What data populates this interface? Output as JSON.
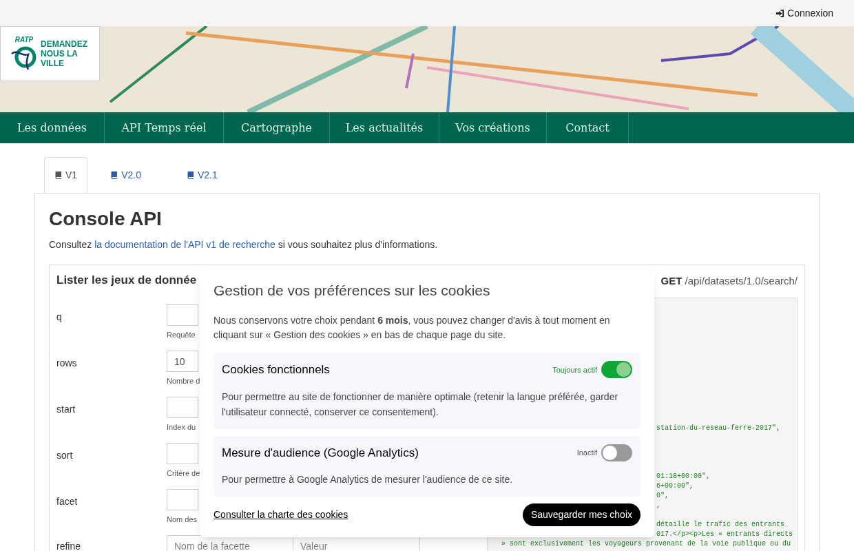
{
  "topbar": {
    "login": "Connexion"
  },
  "logo": {
    "brand": "RATP",
    "tagline": "DEMANDEZ NOUS LA VILLE"
  },
  "nav": [
    "Les données",
    "API Temps réel",
    "Cartographe",
    "Les actualités",
    "Vos créations",
    "Contact"
  ],
  "version_tabs": [
    {
      "label": "V1",
      "selected": true
    },
    {
      "label": "V2.0",
      "selected": false
    },
    {
      "label": "V2.1",
      "selected": false
    }
  ],
  "console": {
    "title": "Console API",
    "intro_before": "Consultez ",
    "intro_link": "la documentation de l'API v1 de recherche",
    "intro_after": " si vous souhaitez plus d'informations.",
    "section_title": "Lister les jeux de donnée",
    "method": "GET",
    "endpoint": "/api/datasets/1.0/search/",
    "params": [
      {
        "name": "q",
        "help": "Requête"
      },
      {
        "name": "rows",
        "value": "10",
        "help": "Nombre d"
      },
      {
        "name": "start",
        "help": "Index du"
      },
      {
        "name": "sort",
        "help": "Critère de"
      },
      {
        "name": "facet",
        "help": "Nom des"
      }
    ],
    "refine": {
      "name": "refine",
      "placeholder_key": "Nom de la facette",
      "placeholder_value": "Valeur"
    },
    "code_lines": [
      {
        "kind": "clipped",
        "text": "station-du-reseau-ferre-2017\","
      },
      {
        "kind": "gap"
      },
      {
        "kind": "gap"
      },
      {
        "kind": "gap"
      },
      {
        "kind": "gap"
      },
      {
        "kind": "clipped",
        "text": "01:18+00:00\","
      },
      {
        "kind": "clipped",
        "text": "6+00:00\","
      },
      {
        "kind": "clipped",
        "text": "0\","
      },
      {
        "kind": "clipped",
        "text": ","
      },
      {
        "kind": "gap"
      },
      {
        "kind": "clipped",
        "text": "détaille le trafic des entrants"
      },
      {
        "kind": "clipped",
        "text": "017.</p><p>Les « entrants directs"
      },
      {
        "kind": "full",
        "text": "» sont exclusivement les voyageurs provenant de la voie publique ou du"
      }
    ]
  },
  "cookie_modal": {
    "title": "Gestion de vos préférences sur les cookies",
    "intro": "Nous conservons votre choix pendant **6 mois**, vous pouvez changer d'avis à tout moment en cliquant sur « Gestion des cookies » en bas de chaque page du site.",
    "categories": [
      {
        "title": "Cookies fonctionnels",
        "status": "Toujours actif",
        "on": true,
        "description": "Pour permettre au site de fonctionner de manière optimale (retenir la langue préférée, garder l'utilisateur connecté, conserver ce consentement)."
      },
      {
        "title": "Mesure d'audience (Google Analytics)",
        "status": "Inactif",
        "on": false,
        "description": "Pour permettre à Google Analytics de mesurer l'audience de ce site."
      }
    ],
    "policy_link": "Consulter la charte des cookies",
    "save_button": "Sauvegarder mes choix"
  }
}
